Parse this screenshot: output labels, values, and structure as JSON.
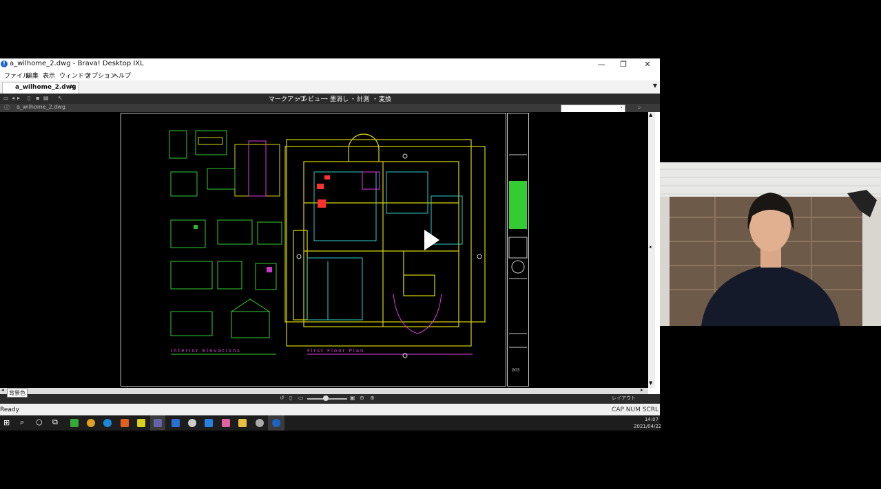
{
  "window": {
    "title": "a_wilhome_2.dwg - Brava! Desktop IXL",
    "controls": {
      "minimize": "—",
      "restore": "❐",
      "close": "✕"
    }
  },
  "menubar": [
    "ファイル",
    "編集",
    "表示",
    "ウィンドウ",
    "オプション",
    "ヘルプ"
  ],
  "tab": {
    "label": "a_wilhome_2.dwg",
    "close": "✕"
  },
  "toolbar": {
    "menus": [
      "マークアップ",
      "レビュー",
      "墨消し",
      "計測",
      "変換"
    ],
    "separator": "・"
  },
  "subbar": {
    "path": "a_wilhome_2.dwg"
  },
  "drawing": {
    "left_caption": "Interior Elevations",
    "right_caption": "First Floor Plan",
    "sheet_number": "003"
  },
  "bottombar": {
    "layout_label": "レイアウト"
  },
  "tooltip": "背景色",
  "statusbar": {
    "ready": "Ready",
    "indicators": "CAP NUM SCRL"
  },
  "taskbar": {
    "time": "14:07",
    "date": "2021/04/22"
  },
  "colors": {
    "cad_green": "#33cc33",
    "cad_yellow": "#d8d800",
    "cad_magenta": "#e040e0",
    "cad_cyan": "#33cccc"
  }
}
